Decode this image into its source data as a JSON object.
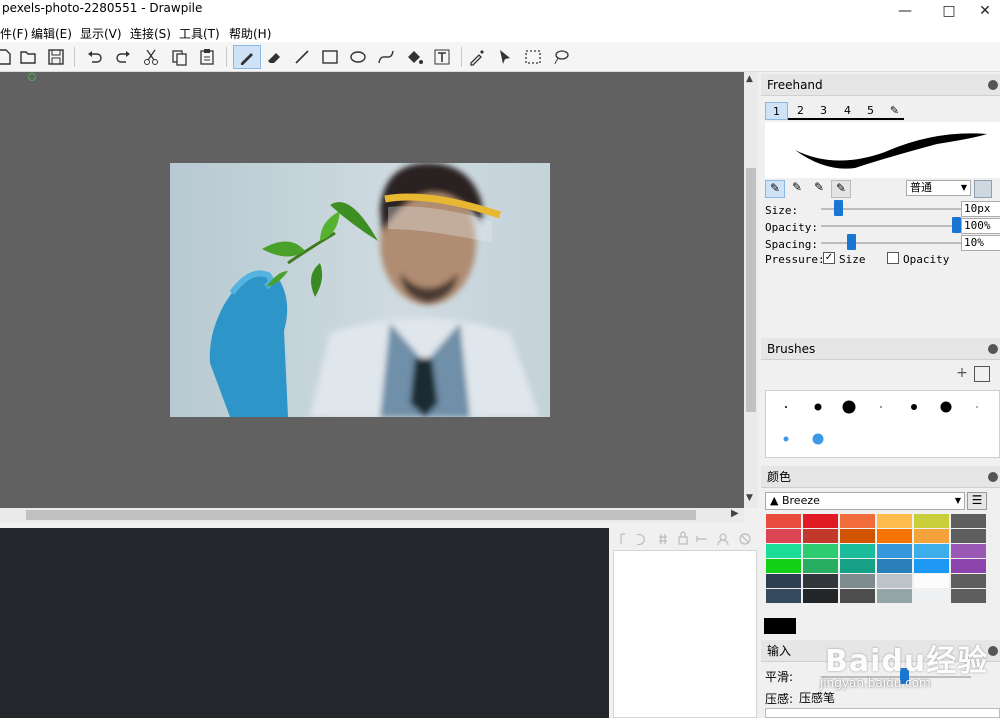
{
  "window": {
    "title": "pexels-photo-2280551 - Drawpile"
  },
  "menu": [
    "件(F)",
    "编辑(E)",
    "显示(V)",
    "连接(S)",
    "工具(T)",
    "帮助(H)"
  ],
  "freehand": {
    "title": "Freehand",
    "tabs": [
      "1",
      "2",
      "3",
      "4",
      "5"
    ],
    "blend_mode": "普通",
    "size_label": "Size:",
    "size_value": "10px",
    "size_fraction": 0.1,
    "opacity_label": "Opacity:",
    "opacity_value": "100%",
    "opacity_fraction": 1.0,
    "spacing_label": "Spacing:",
    "spacing_value": "10%",
    "spacing_fraction": 0.2,
    "pressure_label": "Pressure:",
    "pressure_size": "Size",
    "pressure_size_checked": true,
    "pressure_opacity": "Opacity",
    "pressure_opacity_checked": false
  },
  "brushes": {
    "title": "Brushes"
  },
  "colors": {
    "title": "颜色",
    "palette_name": "Breeze",
    "swatches": [
      [
        "#e74c3c",
        "#e01b24",
        "#f26b3a",
        "#fdbc4b",
        "#c9ce3b",
        "#5e5e5e"
      ],
      [
        "#da4453",
        "#c0392b",
        "#d35400",
        "#f67400",
        "#f4a23a",
        "#5e5e5e"
      ],
      [
        "#1cdc9a",
        "#2ecc71",
        "#1abc9c",
        "#3498db",
        "#3daee9",
        "#9b59b6"
      ],
      [
        "#11d116",
        "#27ae60",
        "#16a085",
        "#2980b9",
        "#1d99f3",
        "#8e44ad"
      ],
      [
        "#2c3e50",
        "#31363b",
        "#7f8c8d",
        "#bdc3c7",
        "#fcfcfc",
        "#5e5e5e"
      ],
      [
        "#34495e",
        "#232629",
        "#4d4d4d",
        "#95a5a6",
        "#eff0f1",
        "#5e5e5e"
      ]
    ],
    "current": "#000000"
  },
  "stabilizer": {
    "title": "输入",
    "smoothing_label": "平滑:",
    "pressure_label": "压感:",
    "pressure_value": "压感笔"
  },
  "watermark": {
    "brand": "Baidu经验",
    "url": "jingyan.baidu.com"
  }
}
